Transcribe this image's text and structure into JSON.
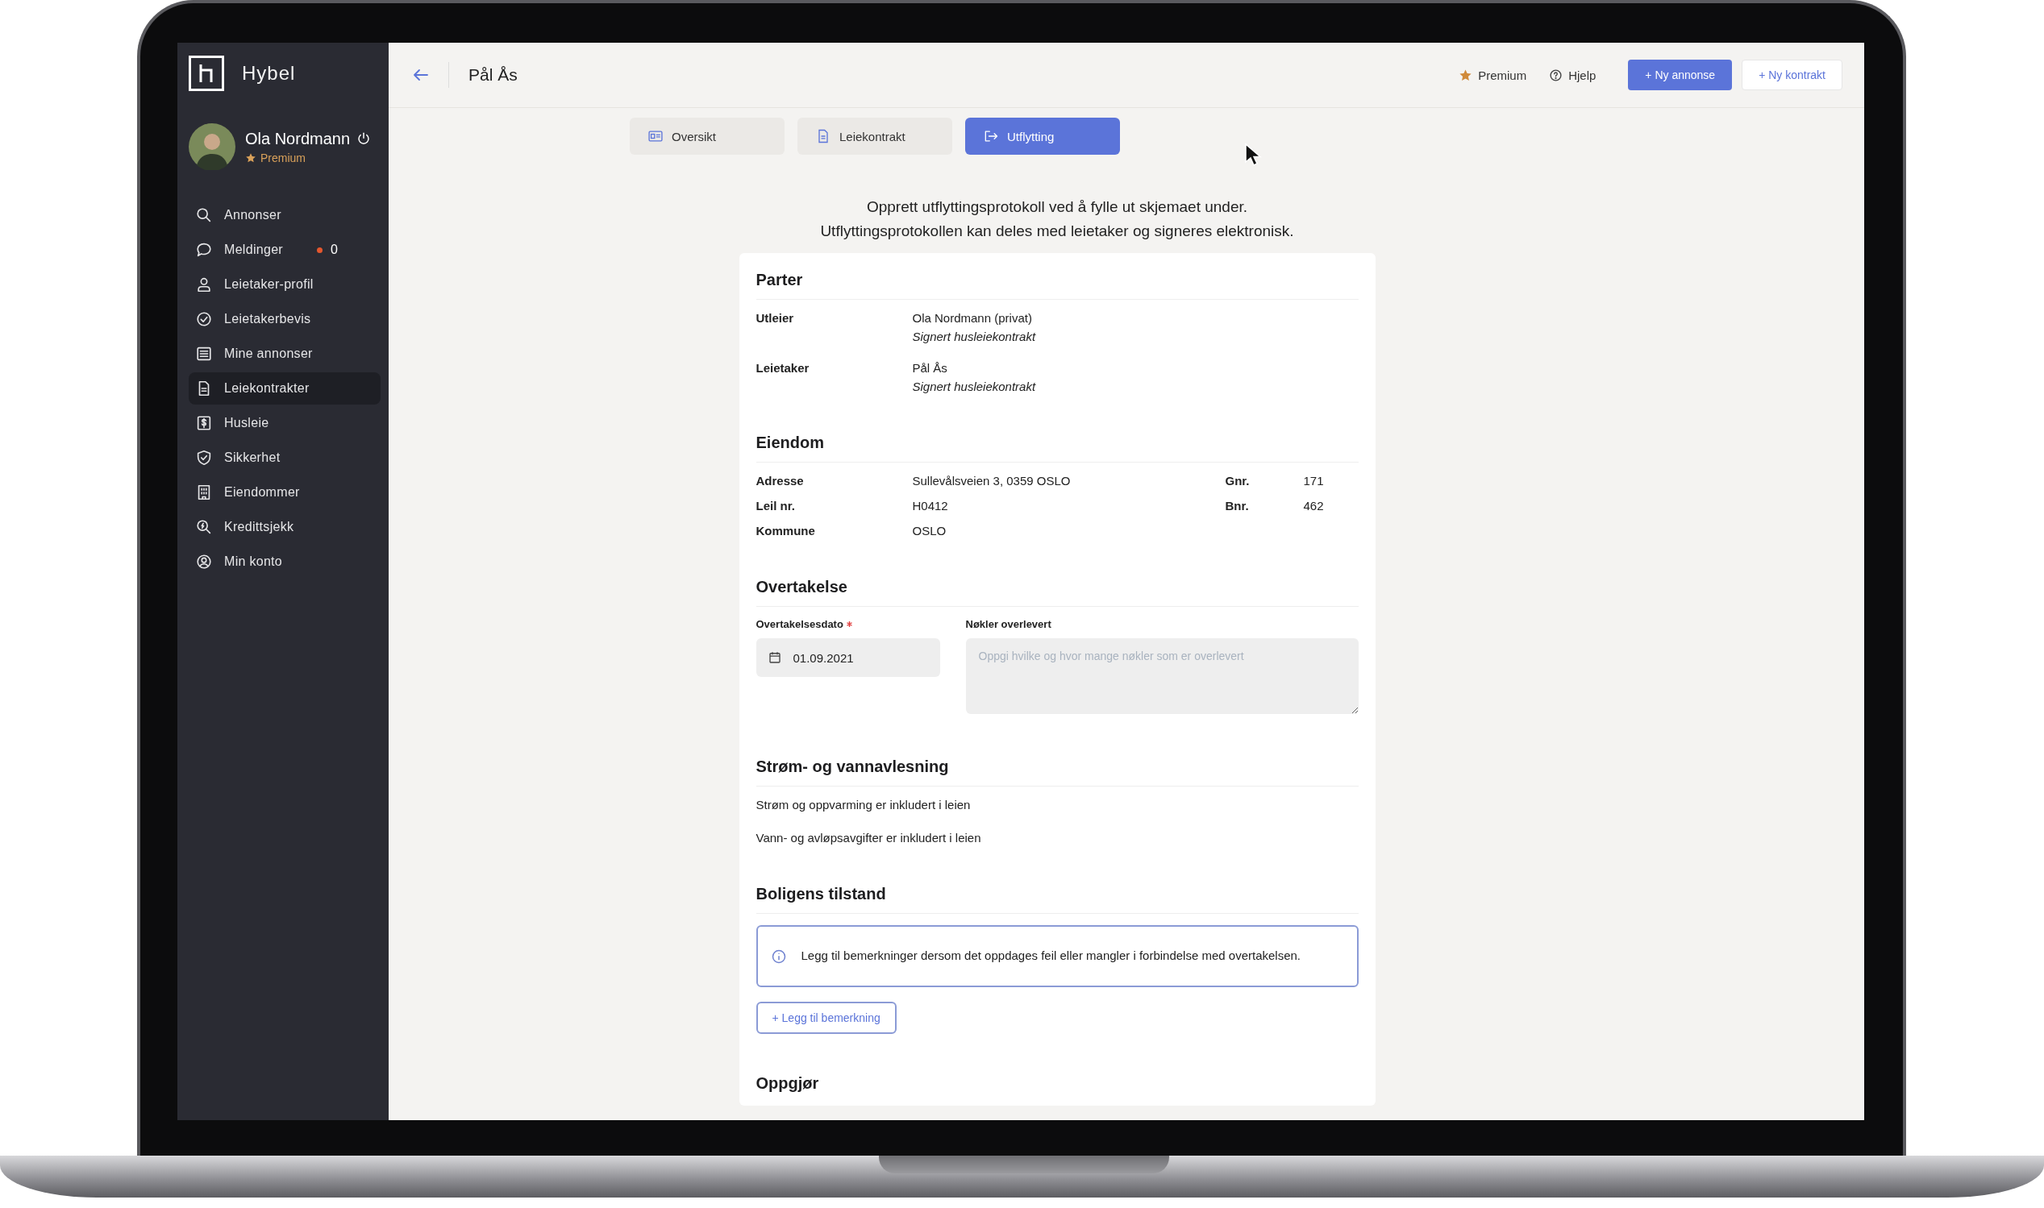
{
  "app": {
    "logo_text": "Hybel",
    "user": {
      "name": "Ola Nordmann",
      "badge": "Premium"
    }
  },
  "sidebar": {
    "items": [
      {
        "label": "Annonser",
        "selected": false
      },
      {
        "label": "Meldinger",
        "selected": false,
        "count": "0"
      },
      {
        "label": "Leietaker-profil",
        "selected": false
      },
      {
        "label": "Leietakerbevis",
        "selected": false
      },
      {
        "label": "Mine annonser",
        "selected": false
      },
      {
        "label": "Leiekontrakter",
        "selected": true
      },
      {
        "label": "Husleie",
        "selected": false
      },
      {
        "label": "Sikkerhet",
        "selected": false
      },
      {
        "label": "Eiendommer",
        "selected": false
      },
      {
        "label": "Kredittsjekk",
        "selected": false
      },
      {
        "label": "Min konto",
        "selected": false
      }
    ]
  },
  "header": {
    "title": "Pål Ås",
    "links": [
      {
        "label": "Premium"
      },
      {
        "label": "Hjelp"
      }
    ],
    "buttons": [
      {
        "label": "+ Ny annonse",
        "kind": "primary"
      },
      {
        "label": "+ Ny kontrakt",
        "kind": "secondary"
      }
    ]
  },
  "tabs": [
    {
      "label": "Oversikt",
      "selected": false
    },
    {
      "label": "Leiekontrakt",
      "selected": false
    },
    {
      "label": "Utflytting",
      "selected": true
    }
  ],
  "intro": [
    "Opprett utflyttingsprotokoll ved å fylle ut skjemaet under.",
    "Utflyttingsprotokollen kan deles med leietaker og signeres elektronisk."
  ],
  "sections": [
    {
      "kind": "parties",
      "title": "Parter",
      "rows": [
        {
          "label": "Utleier",
          "name": "Ola Nordmann (privat)",
          "status": "Signert husleiekontrakt"
        },
        {
          "label": "Leietaker",
          "name": "Pål Ås",
          "status": "Signert husleiekontrakt"
        }
      ]
    },
    {
      "kind": "property",
      "title": "Eiendom",
      "rows": [
        {
          "label": "Adresse",
          "value": "Sullevålsveien 3, 0359 OSLO",
          "extra_label": "Gnr.",
          "extra_value": "171"
        },
        {
          "label": "Leil nr.",
          "value": "H0412",
          "extra_label": "Bnr.",
          "extra_value": "462"
        },
        {
          "label": "Kommune",
          "value": "OSLO"
        }
      ]
    },
    {
      "kind": "handover",
      "title": "Overtakelse",
      "fields": [
        {
          "kind": "date",
          "label": "Overtakelsesdato",
          "required": true,
          "value": "01.09.2021"
        },
        {
          "kind": "textarea",
          "label": "Nøkler overlevert",
          "required": false,
          "placeholder": "Oppgi hvilke og hvor mange nøkler som er overlevert"
        }
      ]
    },
    {
      "kind": "text",
      "title": "Strøm- og vannavlesning",
      "lines": [
        "Strøm og oppvarming er inkludert i leien",
        "Vann- og avløpsavgifter er inkludert i leien"
      ]
    },
    {
      "kind": "remarks",
      "title": "Boligens tilstand",
      "info": "Legg til bemerkninger dersom det oppdages feil eller mangler i forbindelse med overtakelsen.",
      "button": "+ Legg til bemerkning"
    },
    {
      "kind": "heading",
      "title": "Oppgjør"
    }
  ]
}
